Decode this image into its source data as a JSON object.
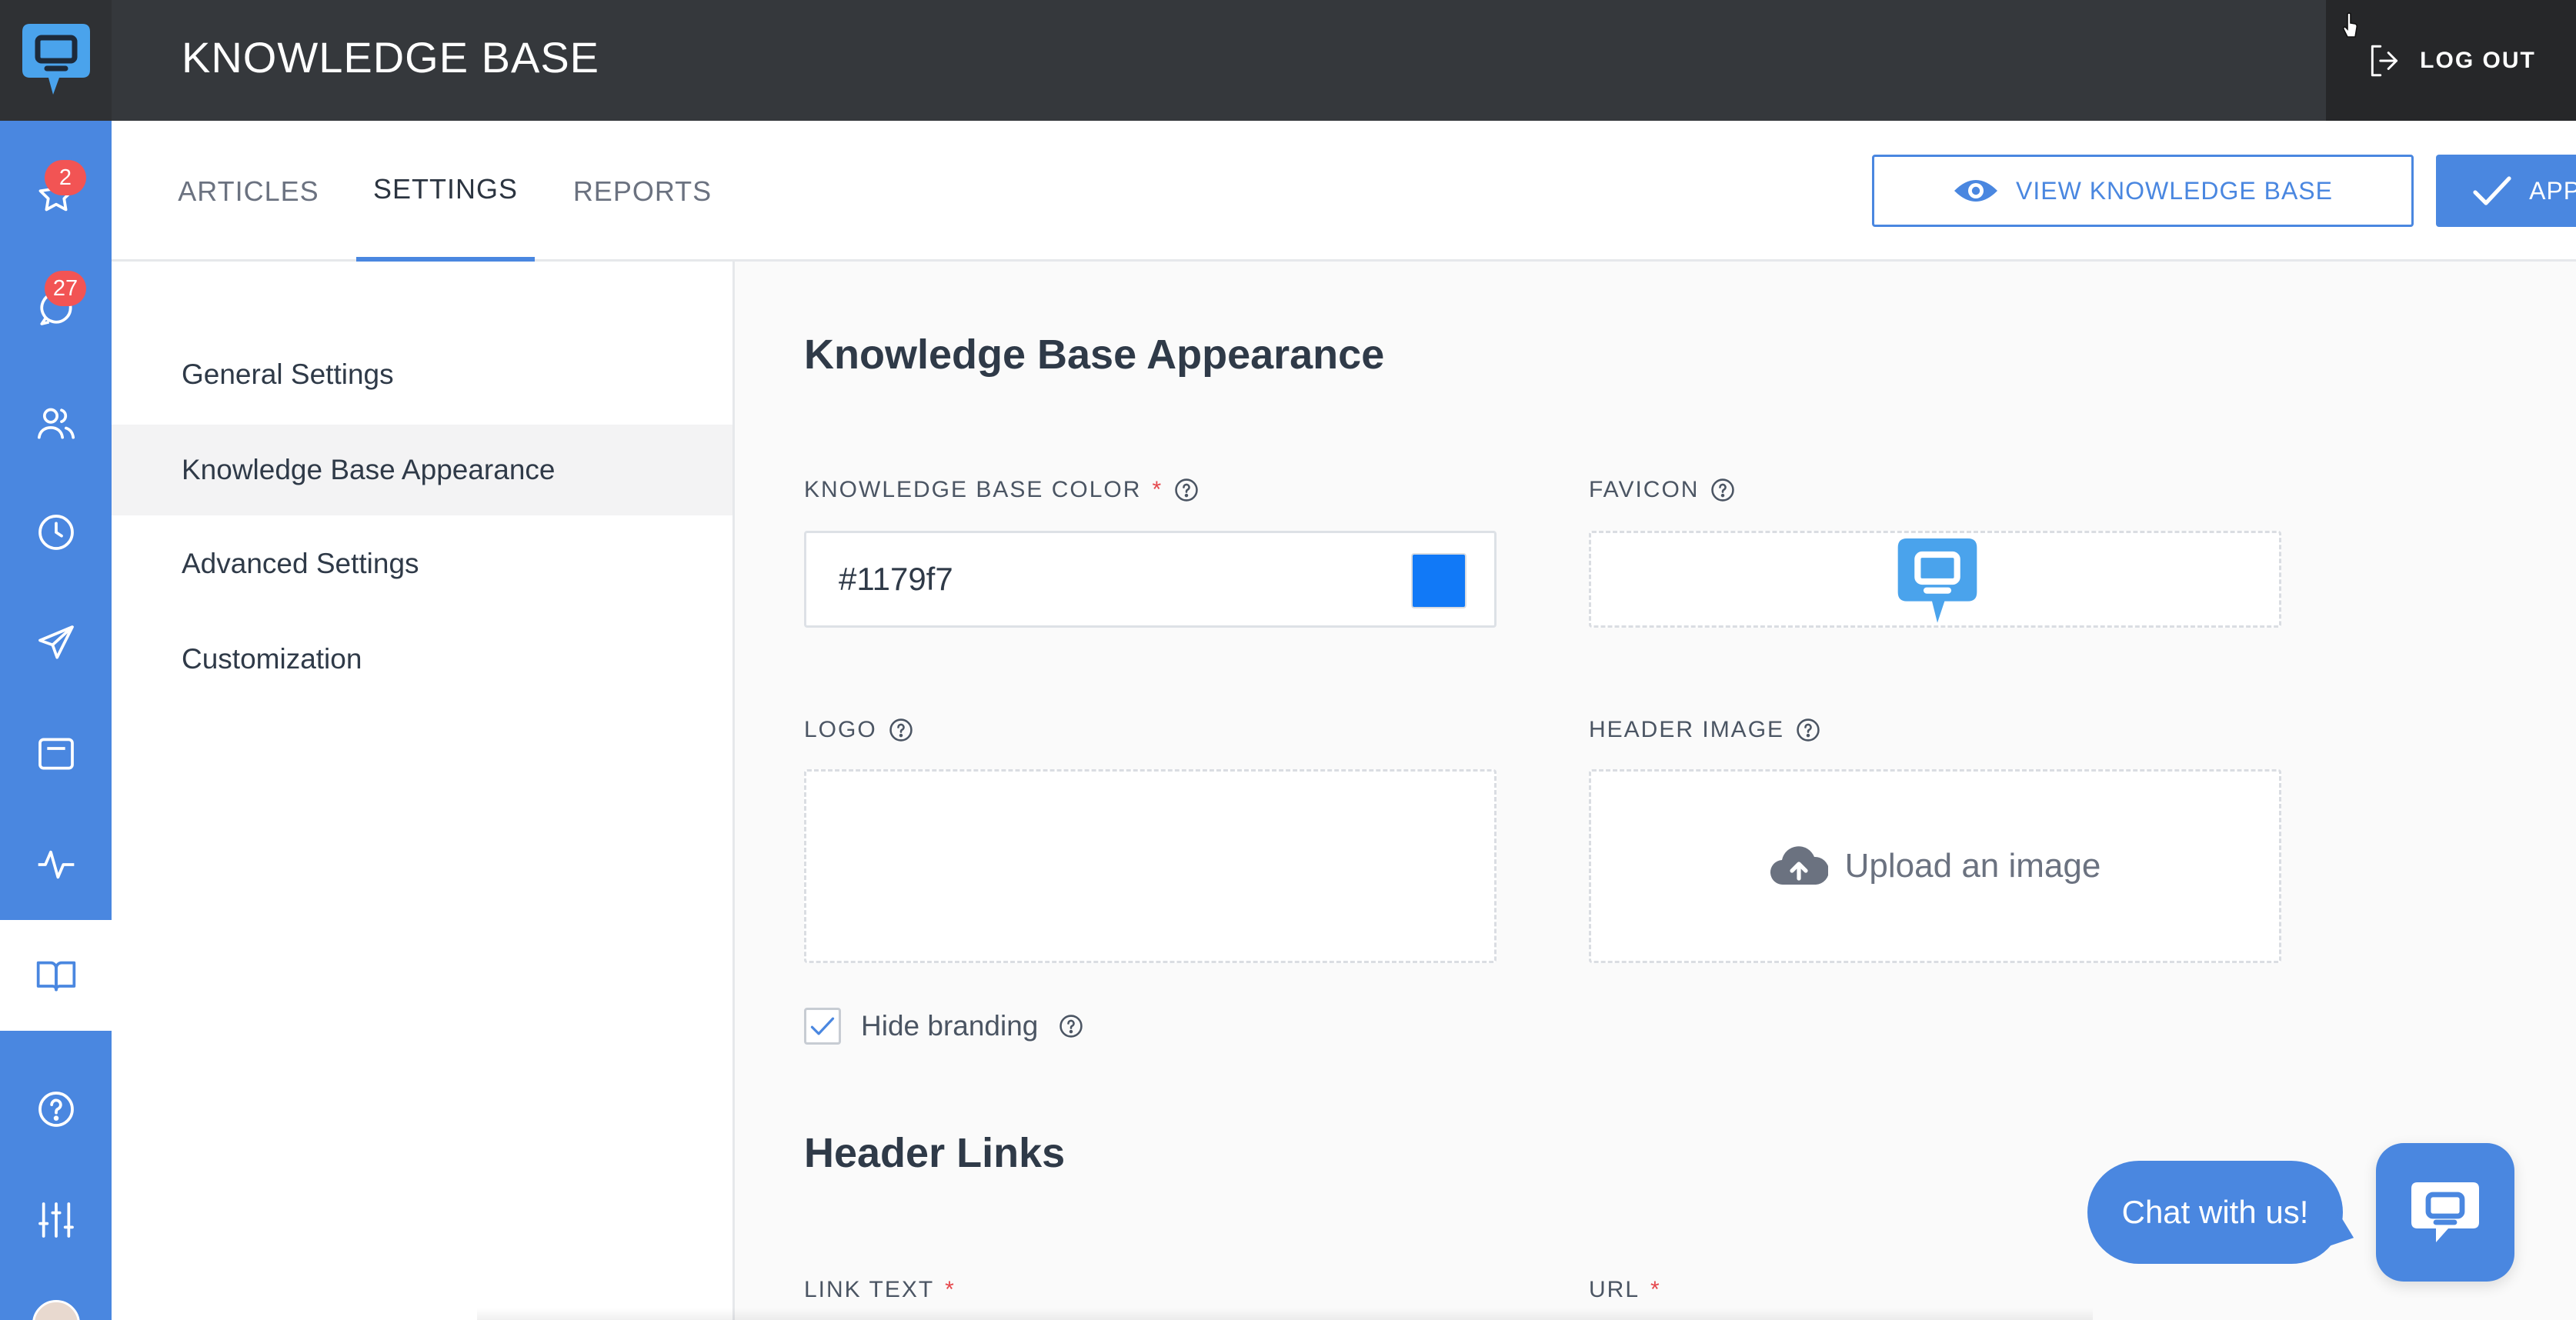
{
  "app": {
    "title": "KNOWLEDGE BASE",
    "logout_label": "LOG OUT"
  },
  "rail": {
    "items": [
      {
        "icon": "star-icon",
        "badge": "2"
      },
      {
        "icon": "chat-icon",
        "badge": "27"
      },
      {
        "icon": "users-icon",
        "badge": ""
      },
      {
        "icon": "clock-icon",
        "badge": ""
      },
      {
        "icon": "send-icon",
        "badge": ""
      },
      {
        "icon": "ticket-icon",
        "badge": ""
      },
      {
        "icon": "activity-icon",
        "badge": ""
      },
      {
        "icon": "book-icon",
        "badge": "",
        "active": true
      },
      {
        "icon": "help-icon",
        "badge": ""
      },
      {
        "icon": "sliders-icon",
        "badge": ""
      }
    ]
  },
  "tabs": [
    {
      "label": "ARTICLES"
    },
    {
      "label": "SETTINGS",
      "active": true
    },
    {
      "label": "REPORTS"
    }
  ],
  "actions": {
    "view_kb": "VIEW KNOWLEDGE BASE",
    "apply": "APPLY"
  },
  "settings_nav": [
    {
      "label": "General Settings"
    },
    {
      "label": "Knowledge Base Appearance",
      "active": true
    },
    {
      "label": "Advanced Settings"
    },
    {
      "label": "Customization"
    }
  ],
  "appearance": {
    "heading": "Knowledge Base Appearance",
    "color_label": "KNOWLEDGE BASE COLOR",
    "color_value": "#1179f7",
    "favicon_label": "FAVICON",
    "logo_label": "LOGO",
    "header_image_label": "HEADER IMAGE",
    "upload_text": "Upload an image",
    "hide_branding_label": "Hide branding",
    "hide_branding_checked": true
  },
  "header_links": {
    "heading": "Header Links",
    "link_text_label": "LINK TEXT",
    "url_label": "URL"
  },
  "chat_widget": {
    "text": "Chat with us!"
  },
  "colors": {
    "accent": "#4a87e0",
    "topbar": "#35383c",
    "swatch": "#1179f7",
    "badge": "#f25454"
  }
}
